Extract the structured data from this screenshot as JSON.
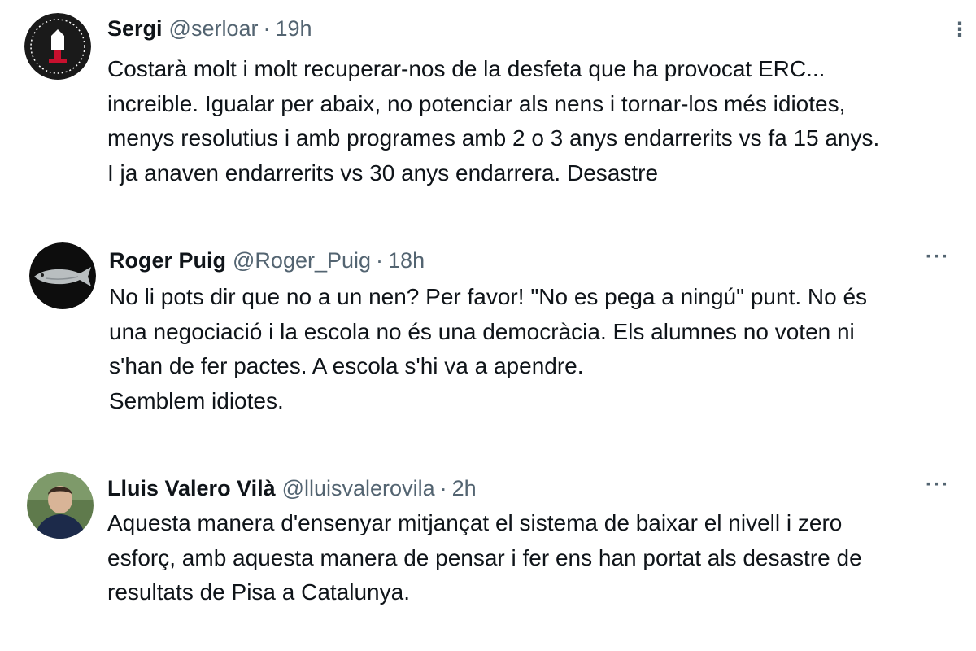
{
  "tweets": [
    {
      "name": "Sergi",
      "handle": "@serloar",
      "separator": "·",
      "time": "19h",
      "more": "⋮",
      "text": "Costarà molt i molt recuperar-nos de la desfeta que ha provocat ERC...\nincreible. Igualar per abaix, no potenciar als nens i tornar-los més idiotes,\nmenys resolutius i amb programes amb 2 o 3 anys endarrerits vs fa 15 anys.\nI ja anaven endarrerits vs 30 anys endarrera. Desastre",
      "avatar_icon": "badge-avatar-icon"
    },
    {
      "name": "Roger Puig",
      "handle": "@Roger_Puig",
      "separator": "·",
      "time": "18h",
      "more": "···",
      "text": "No li pots dir que no a un nen? Per favor! \"No es pega a ningú\" punt. No és\nuna negociació i la escola no és una democràcia. Els alumnes no voten ni\ns'han de fer pactes. A escola s'hi va a apendre.\nSemblem idiotes.",
      "avatar_icon": "fish-avatar-icon"
    },
    {
      "name": "Lluis Valero Vilà",
      "handle": "@lluisvalerovila",
      "separator": "·",
      "time": "2h",
      "more": "···",
      "text": "Aquesta manera d'ensenyar mitjançat el sistema de baixar el nivell i zero\nesforç, amb aquesta manera de pensar i fer ens han portat als desastre de\nresultats de Pisa a Catalunya.",
      "avatar_icon": "person-photo-avatar-icon"
    }
  ],
  "colors": {
    "text": "#0f1419",
    "secondary": "#536471",
    "divider": "#e6ecf0"
  }
}
